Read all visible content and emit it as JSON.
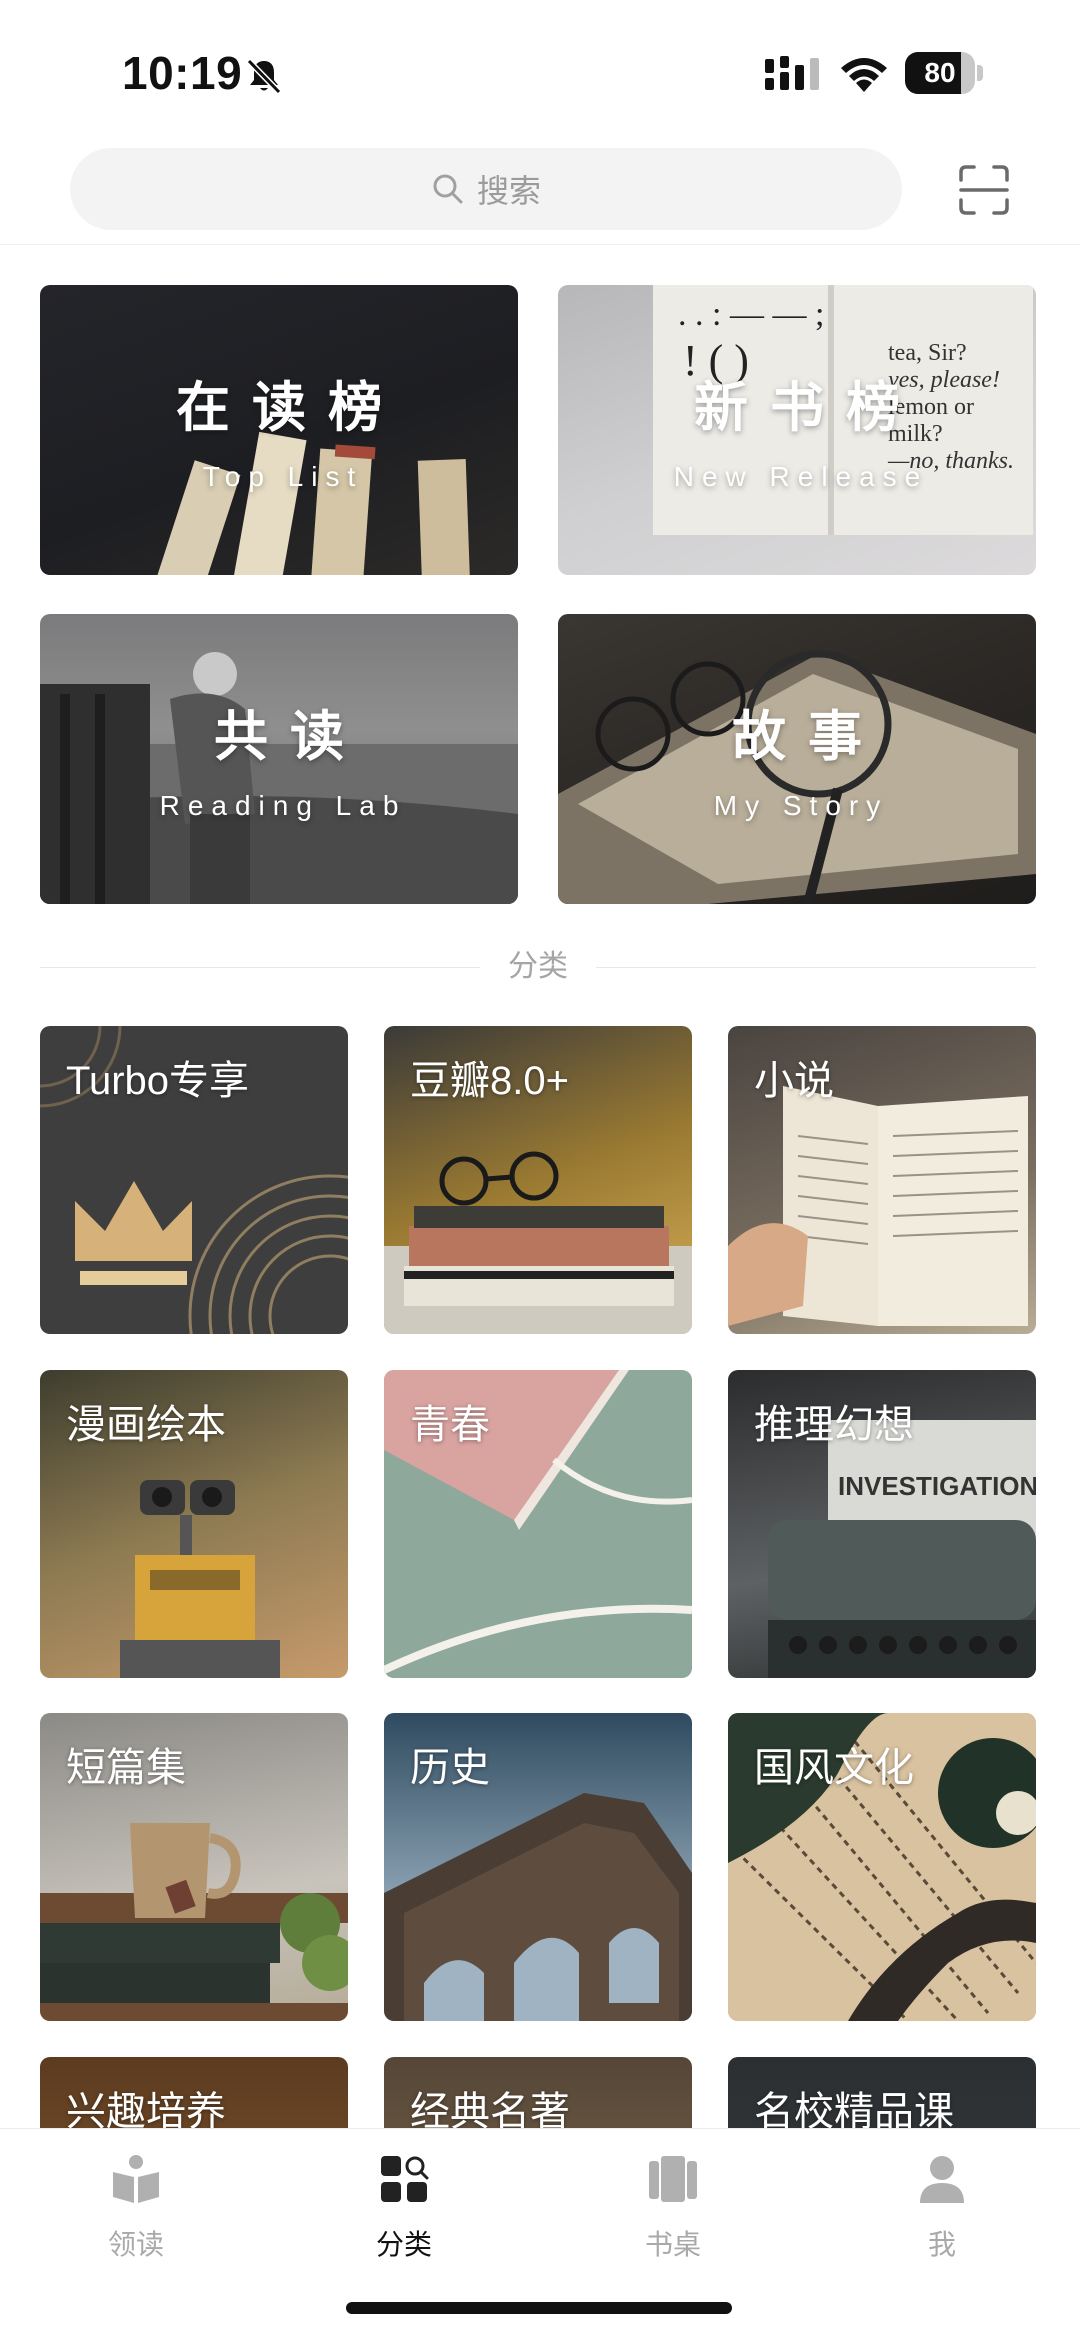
{
  "status_bar": {
    "time": "10:19",
    "battery_level": "80",
    "battery_fraction": 0.8
  },
  "header": {
    "search_placeholder": "搜索"
  },
  "features": [
    {
      "title": "在读榜",
      "subtitle": "Top List"
    },
    {
      "title": "新书榜",
      "subtitle": "New Release"
    },
    {
      "title": "共读",
      "subtitle": "Reading Lab"
    },
    {
      "title": "故事",
      "subtitle": "My Story"
    }
  ],
  "section": {
    "title": "分类"
  },
  "categories": [
    {
      "label": "Turbo专享"
    },
    {
      "label": "豆瓣8.0+"
    },
    {
      "label": "小说"
    },
    {
      "label": "漫画绘本"
    },
    {
      "label": "青春"
    },
    {
      "label": "推理幻想"
    },
    {
      "label": "短篇集"
    },
    {
      "label": "历史"
    },
    {
      "label": "国风文化"
    },
    {
      "label": "兴趣培养"
    },
    {
      "label": "经典名著"
    },
    {
      "label": "名校精品课"
    }
  ],
  "tabs": [
    {
      "label": "领读",
      "icon": "book-open-icon"
    },
    {
      "label": "分类",
      "icon": "category-grid-icon",
      "active": true
    },
    {
      "label": "书桌",
      "icon": "bookshelf-icon"
    },
    {
      "label": "我",
      "icon": "person-icon"
    }
  ],
  "colors": {
    "active_tab": "#111111",
    "inactive_tab": "#a9a9a9",
    "search_bg": "#f3f3f3"
  }
}
